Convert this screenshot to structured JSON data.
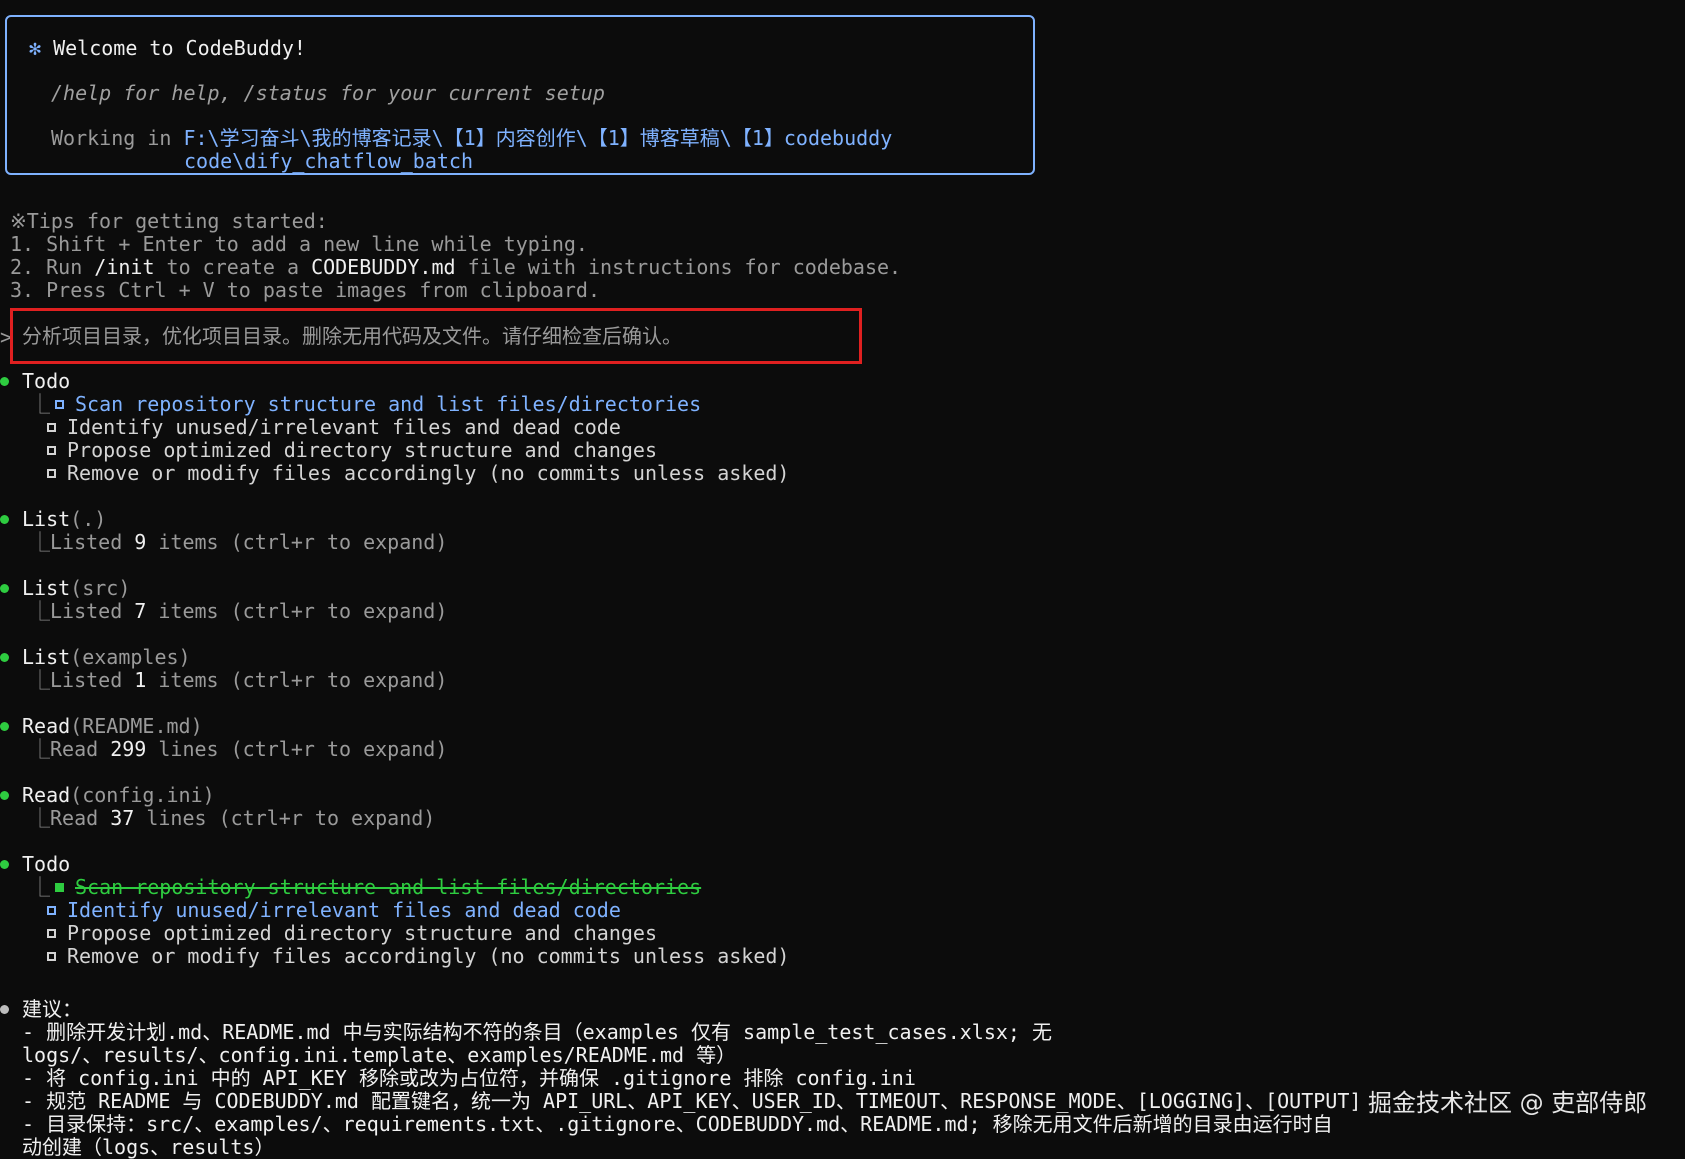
{
  "welcome": {
    "title": "Welcome to CodeBuddy!",
    "help": "/help for help, /status for your current setup",
    "working_label": "Working in",
    "path_line1": "F:\\学习奋斗\\我的博客记录\\【1】内容创作\\【1】博客草稿\\【1】codebuddy",
    "path_line2": "code\\dify_chatflow_batch"
  },
  "tips": {
    "header": "※Tips for getting started:",
    "t1": "1. Shift + Enter to add a new line while typing.",
    "t2_pre": "2. Run ",
    "t2_cmd": "/init",
    "t2_mid": " to create a ",
    "t2_file": "CODEBUDDY.md",
    "t2_post": " file with instructions for codebase.",
    "t3": "3. Press Ctrl + V to paste images from clipboard."
  },
  "prompt": {
    "caret": ">",
    "text": "分析项目目录，优化项目目录。删除无用代码及文件。请仔细检查后确认。"
  },
  "todo1": {
    "title": "Todo",
    "items": [
      "Scan repository structure and list files/directories",
      "Identify unused/irrelevant files and dead code",
      "Propose optimized directory structure and changes",
      "Remove or modify files accordingly (no commits unless asked)"
    ]
  },
  "tools": [
    {
      "name": "List",
      "arg": "(.)",
      "r_pre": "Listed ",
      "r_num": "9",
      "r_post": " items (ctrl+r to expand)"
    },
    {
      "name": "List",
      "arg": "(src)",
      "r_pre": "Listed ",
      "r_num": "7",
      "r_post": " items (ctrl+r to expand)"
    },
    {
      "name": "List",
      "arg": "(examples)",
      "r_pre": "Listed ",
      "r_num": "1",
      "r_post": " items (ctrl+r to expand)"
    },
    {
      "name": "Read",
      "arg": "(README.md)",
      "r_pre": "Read ",
      "r_num": "299",
      "r_post": " lines (ctrl+r to expand)"
    },
    {
      "name": "Read",
      "arg": "(config.ini)",
      "r_pre": "Read ",
      "r_num": "37",
      "r_post": " lines (ctrl+r to expand)"
    }
  ],
  "todo2": {
    "title": "Todo",
    "items": [
      "Scan repository structure and list files/directories",
      "Identify unused/irrelevant files and dead code",
      "Propose optimized directory structure and changes",
      "Remove or modify files accordingly (no commits unless asked)"
    ]
  },
  "suggestions": {
    "title": "建议：",
    "lines": [
      "- 删除开发计划.md、README.md 中与实际结构不符的条目（examples 仅有 sample_test_cases.xlsx; 无",
      "logs/、results/、config.ini.template、examples/README.md 等）",
      "- 将 config.ini 中的 API_KEY 移除或改为占位符，并确保 .gitignore 排除 config.ini",
      "- 规范 README 与 CODEBUDDY.md 配置键名，统一为 API_URL、API_KEY、USER_ID、TIMEOUT、RESPONSE_MODE、[LOGGING]、[OUTPUT]",
      "- 目录保持：src/、examples/、requirements.txt、.gitignore、CODEBUDDY.md、README.md; 移除无用文件后新增的目录由运行时自",
      "动创建（logs、results）"
    ]
  },
  "watermark": "掘金技术社区 @ 吏部侍郎"
}
